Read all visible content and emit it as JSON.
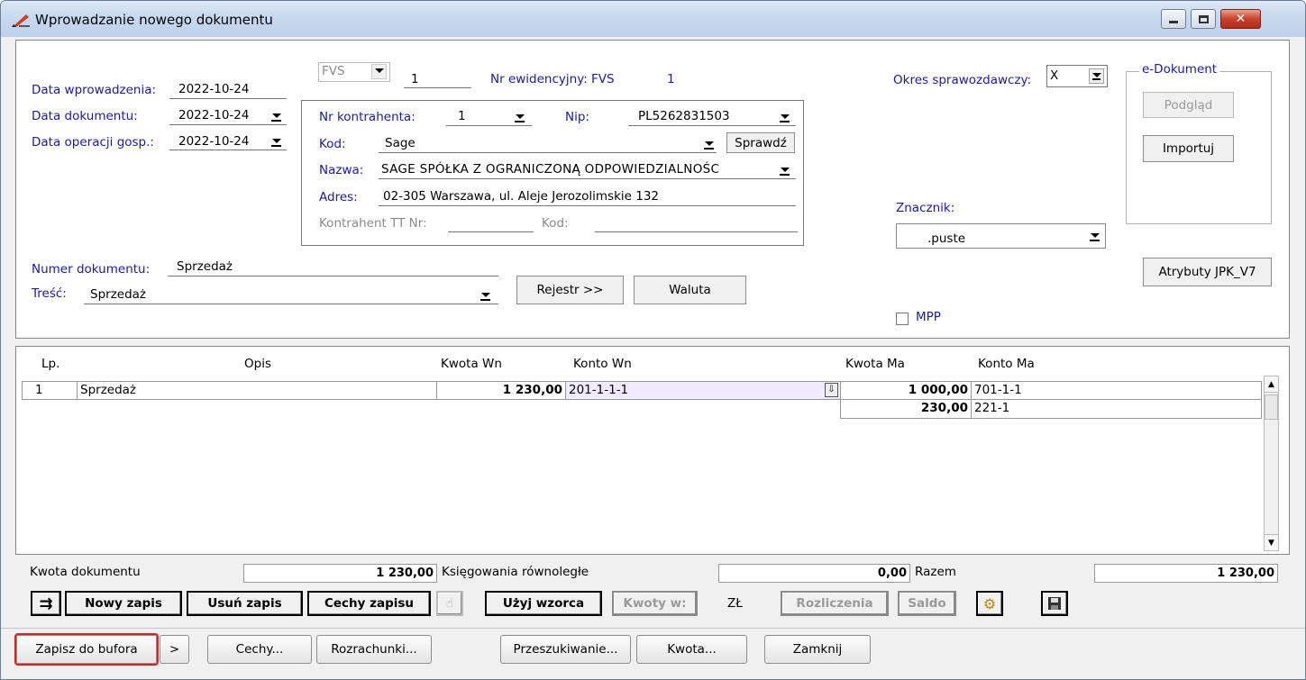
{
  "window": {
    "title": "Wprowadzanie nowego dokumentu"
  },
  "header": {
    "data_wprowadzenia_label": "Data wprowadzenia:",
    "data_wprowadzenia": "2022-10-24",
    "data_dokumentu_label": "Data dokumentu:",
    "data_dokumentu": "2022-10-24",
    "data_operacji_label": "Data operacji gosp.:",
    "data_operacji": "2022-10-24",
    "typ": "FVS",
    "numer": "1",
    "nr_ewid_label": "Nr ewidencyjny: FVS",
    "nr_ewid": "1",
    "numer_dok_label": "Numer dokumentu:",
    "numer_dok": "Sprzedaż",
    "tresc_label": "Treść:",
    "tresc": "Sprzedaż",
    "rejestr_btn": "Rejestr >>",
    "waluta_btn": "Waluta"
  },
  "kontrahent": {
    "nr_label": "Nr kontrahenta:",
    "nr": "1",
    "nip_label": "Nip:",
    "nip": "PL5262831503",
    "kod_label": "Kod:",
    "kod": "Sage",
    "sprawdz_btn": "Sprawdź",
    "nazwa_label": "Nazwa:",
    "nazwa": "SAGE SPÓŁKA Z OGRANICZONĄ ODPOWIEDZIALNOŚC",
    "adres_label": "Adres:",
    "adres": "02-305 Warszawa, ul. Aleje Jerozolimskie 132",
    "tt_label": "Kontrahent TT Nr:",
    "tt_kod_label": "Kod:"
  },
  "right": {
    "okres_label": "Okres sprawozdawczy:",
    "okres": "X",
    "edok_label": "e-Dokument",
    "podglad_btn": "Podgląd",
    "importuj_btn": "Importuj",
    "znacznik_label": "Znacznik:",
    "znacznik": ".puste",
    "jpk_btn": "Atrybuty JPK_V7",
    "mpp_label": "MPP"
  },
  "grid": {
    "headers": {
      "lp": "Lp.",
      "opis": "Opis",
      "kwota_wn": "Kwota Wn",
      "konto_wn": "Konto Wn",
      "kwota_ma": "Kwota Ma",
      "konto_ma": "Konto Ma"
    },
    "rows": [
      {
        "lp": "1",
        "opis": "Sprzedaż",
        "kwota_wn": "1 230,00",
        "konto_wn": "201-1-1-1",
        "kwota_ma": "1 000,00",
        "konto_ma": "701-1-1"
      },
      {
        "kwota_ma": "230,00",
        "konto_ma": "221-1"
      }
    ]
  },
  "totals": {
    "kwota_dok_label": "Kwota dokumentu",
    "kwota_dok": "1 230,00",
    "ksieg_label": "Księgowania równoległe",
    "ksieg": "0,00",
    "razem_label": "Razem",
    "razem": "1 230,00"
  },
  "toolbar": {
    "nowy": "Nowy zapis",
    "usun": "Usuń zapis",
    "cechy": "Cechy zapisu",
    "uzyj": "Użyj wzorca",
    "kwoty": "Kwoty w:",
    "zl": "ZŁ",
    "rozliczenia": "Rozliczenia",
    "saldo": "Saldo"
  },
  "bottom": {
    "zapisz": "Zapisz do bufora",
    "more": ">",
    "cechy": "Cechy...",
    "rozrachunki": "Rozrachunki...",
    "przeszukiwanie": "Przeszukiwanie...",
    "kwota": "Kwota...",
    "zamknij": "Zamknij"
  }
}
